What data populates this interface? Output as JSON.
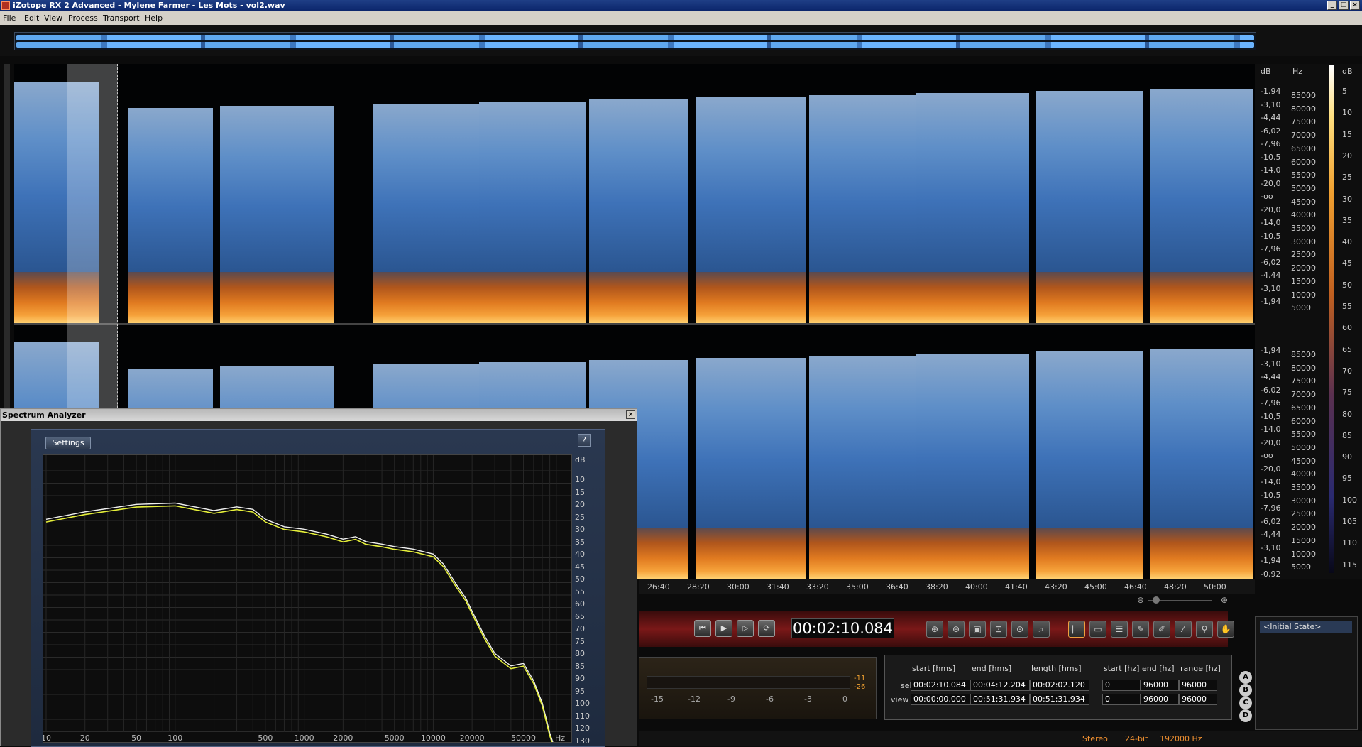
{
  "window": {
    "title": "iZotope RX 2 Advanced - Mylene Farmer - Les Mots - vol2.wav"
  },
  "menu": [
    "File",
    "Edit",
    "View",
    "Process",
    "Transport",
    "Help"
  ],
  "db_scale": {
    "unit": "dB",
    "ticks": [
      "-1,94",
      "-3,10",
      "-4,44",
      "-6,02",
      "-7,96",
      "-10,5",
      "-14,0",
      "-20,0",
      "-oo",
      "-20,0",
      "-14,0",
      "-10,5",
      "-7,96",
      "-6,02",
      "-4,44",
      "-3,10",
      "-1,94",
      "-0,92"
    ]
  },
  "hz_scale": {
    "unit": "Hz",
    "ticks": [
      "85000",
      "80000",
      "75000",
      "70000",
      "65000",
      "60000",
      "55000",
      "50000",
      "45000",
      "40000",
      "35000",
      "30000",
      "25000",
      "20000",
      "15000",
      "10000",
      "5000"
    ]
  },
  "color_scale": {
    "unit": "dB",
    "ticks": [
      "5",
      "10",
      "15",
      "20",
      "25",
      "30",
      "35",
      "40",
      "45",
      "50",
      "55",
      "60",
      "65",
      "70",
      "75",
      "80",
      "85",
      "90",
      "95",
      "100",
      "105",
      "110",
      "115"
    ]
  },
  "time_axis": [
    "26:40",
    "28:20",
    "30:00",
    "31:40",
    "33:20",
    "35:00",
    "36:40",
    "38:20",
    "40:00",
    "41:40",
    "43:20",
    "45:00",
    "46:40",
    "48:20",
    "50:00"
  ],
  "transport": {
    "time": "00:02:10.084",
    "buttons": [
      "rewind",
      "play",
      "play-selection",
      "loop"
    ]
  },
  "meter": {
    "scale": [
      "-15",
      "-12",
      "-9",
      "-6",
      "-3",
      "0"
    ],
    "readout": [
      "-11",
      "-26"
    ]
  },
  "selection_info": {
    "headers": [
      "start [hms]",
      "end [hms]",
      "length [hms]",
      "start [hz]",
      "end [hz]",
      "range [hz]"
    ],
    "rows": [
      {
        "label": "sel",
        "values": [
          "00:02:10.084",
          "00:04:12.204",
          "00:02:02.120",
          "0",
          "96000",
          "96000"
        ]
      },
      {
        "label": "view",
        "values": [
          "00:00:00.000",
          "00:51:31.934",
          "00:51:31.934",
          "0",
          "96000",
          "96000"
        ]
      }
    ]
  },
  "history": {
    "items": [
      "<Initial State>"
    ],
    "snapshots": [
      "A",
      "B",
      "C",
      "D"
    ]
  },
  "status": {
    "channels": "Stereo",
    "bit_depth": "24-bit",
    "sample_rate": "192000 Hz"
  },
  "analyzer": {
    "title": "Spectrum Analyzer",
    "settings_label": "Settings",
    "help_label": "?",
    "db_unit": "dB",
    "db_ticks": [
      "10",
      "15",
      "20",
      "25",
      "30",
      "35",
      "40",
      "45",
      "50",
      "55",
      "60",
      "65",
      "70",
      "75",
      "80",
      "85",
      "90",
      "95",
      "100",
      "110",
      "120",
      "130"
    ],
    "freq_ticks": [
      "10",
      "20",
      "50",
      "100",
      "500",
      "1000",
      "2000",
      "5000",
      "10000",
      "20000",
      "50000",
      "Hz"
    ]
  },
  "colors": {
    "accent": "#f09030",
    "transport_red": "#7a1818",
    "spectrum_blue": "#3e72b8",
    "spectrum_orange": "#e07a20",
    "curve_yellow": "#e6f03a",
    "curve_white": "#f0f0f0"
  }
}
